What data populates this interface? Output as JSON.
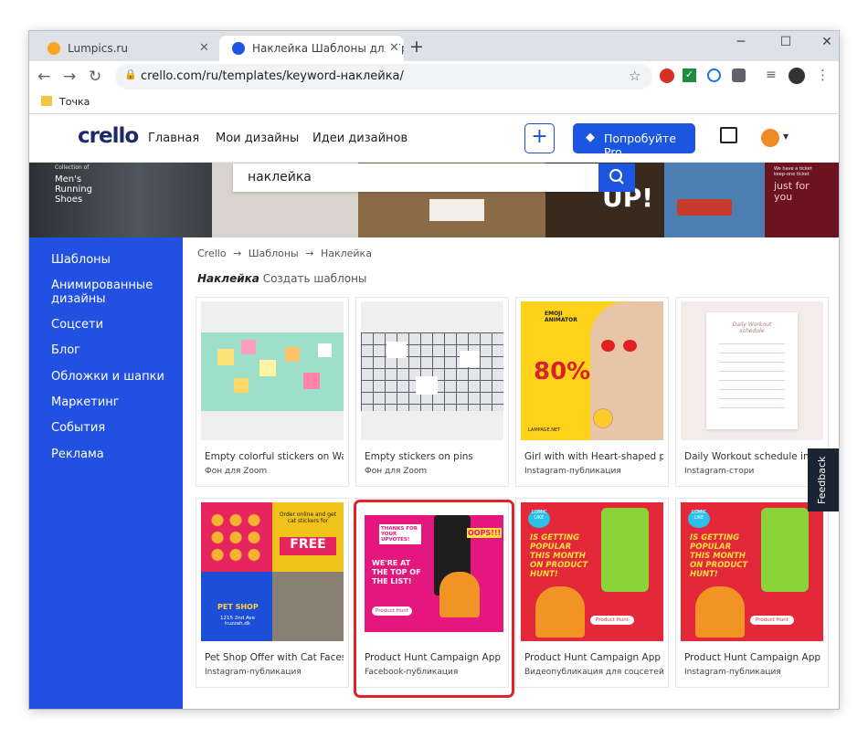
{
  "browser": {
    "tabs": [
      {
        "title": "Lumpics.ru"
      },
      {
        "title": "Наклейка Шаблоны для Графич"
      }
    ],
    "url": "crello.com/ru/templates/keyword-наклейка/",
    "bookmark": "Точка"
  },
  "site": {
    "logo": "crello",
    "nav": [
      "Главная",
      "Мои дизайны",
      "Идеи дизайнов"
    ],
    "plus": "+",
    "pro": "Попробуйте Pro",
    "search": "наклейка",
    "banner_text": {
      "shoes": "Men's Running Shoes",
      "shoes_small": "Collection of",
      "ticket_small": "We have a ticket keep-one ticket",
      "ticket": "just for you",
      "up": "UP!"
    },
    "sidebar": [
      "Шаблоны",
      "Анимированные дизайны",
      "Соцсети",
      "Блог",
      "Обложки и шапки",
      "Маркетинг",
      "События",
      "Реклама"
    ],
    "breadcrumb": [
      "Crello",
      "Шаблоны",
      "Наклейка"
    ],
    "heading_keyword": "Наклейка",
    "heading_rest": "Создать шаблоны",
    "cards": [
      {
        "title": "Empty colorful stickers on Wall",
        "sub": "Фон для Zoom"
      },
      {
        "title": "Empty stickers on pins",
        "sub": "Фон для Zoom"
      },
      {
        "title": "Girl with with Heart-shaped p...",
        "sub": "Instagram-публикация"
      },
      {
        "title": "Daily Workout schedule in pink",
        "sub": "Instagram-стори"
      },
      {
        "title": "Pet Shop Offer with Cat Faces ...",
        "sub": "Instagram-публикация"
      },
      {
        "title": "Product Hunt Campaign App l...",
        "sub": "Facebook-публикация"
      },
      {
        "title": "Product Hunt Campaign App ...",
        "sub": "Видеопубликация для соцсетей"
      },
      {
        "title": "Product Hunt Campaign App l...",
        "sub": "Instagram-публикация"
      }
    ],
    "thumb_text": {
      "emoji_title": "EMOJI ANIMATOR",
      "emoji_pct": "80%",
      "emoji_site": "LAMPAGE.NET",
      "workout": "Daily Workout schedule",
      "pet_free": "FREE",
      "pet_order": "Order online and get cat stickers for",
      "pet_shop": "PET SHOP",
      "pet_addr": "1215 2nd Ave huzzah.dk",
      "ph_thanks": "THANKS FOR YOUR UPVOTES!",
      "ph_top": "WE'RE AT THE TOP OF THE LIST!",
      "ph_badge": "Product Hunt",
      "ph_pop": "IS GETTING POPULAR THIS MONTH ON PRODUCT HUNT!",
      "ph_comic": "COMIC LIKE",
      "ph_oops": "OOPS!!!"
    },
    "feedback": "Feedback"
  }
}
